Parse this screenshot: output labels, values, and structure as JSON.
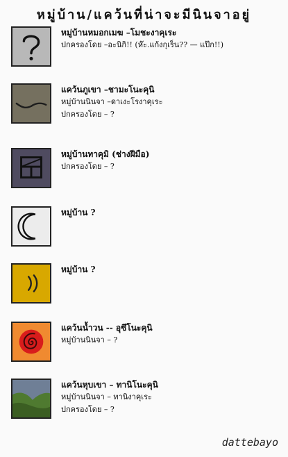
{
  "title": "หมู่บ้าน/แคว้นที่น่าจะมีนินจาอยู่",
  "entries": [
    {
      "id": "mist",
      "lines": [
        "หมู่บ้านหมอกเมฆ –โมชะงาคุเระ",
        "ปกครองโดย –อะนิกิ!! (ห๊ะ.แก้งกุเร็น?? — แป๊ก!!)",
        ""
      ]
    },
    {
      "id": "swamp",
      "lines": [
        "แคว้นภูเขา –ชามะโนะคุนิ",
        "หมู่บ้านนินจา –ดาเงะโรงาคุเระ",
        "ปกครองโดย – ?"
      ]
    },
    {
      "id": "craft",
      "lines": [
        "หมู่บ้านทาคุมิ (ช่างฝีมือ)",
        "ปกครองโดย – ?",
        ""
      ]
    },
    {
      "id": "moon",
      "lines": [
        "หมู่บ้าน ?",
        "",
        ""
      ]
    },
    {
      "id": "sound2",
      "lines": [
        "หมู่บ้าน ?",
        "",
        ""
      ]
    },
    {
      "id": "whirlpool",
      "lines": [
        "แคว้นน้ำวน -- อุซึโนะคุนิ",
        "หมู่บ้านนินจา – ?",
        ""
      ]
    },
    {
      "id": "valley",
      "lines": [
        "แคว้นหุบเขา – ทานิโนะคุนิ",
        "หมู่บ้านนินจา – ทานิงาคุเระ",
        "ปกครองโดย – ?"
      ]
    }
  ],
  "watermark": "dattebayo",
  "colors": {
    "mist": "#b8b8b8",
    "swamp": "#75705f",
    "craft": "#4f4b60",
    "moon": "#ececec",
    "sound2": "#d8a800",
    "whirlpool": "#f08a30",
    "valley_sky": "#6f7f96",
    "valley_hill": "#4f7a30"
  }
}
